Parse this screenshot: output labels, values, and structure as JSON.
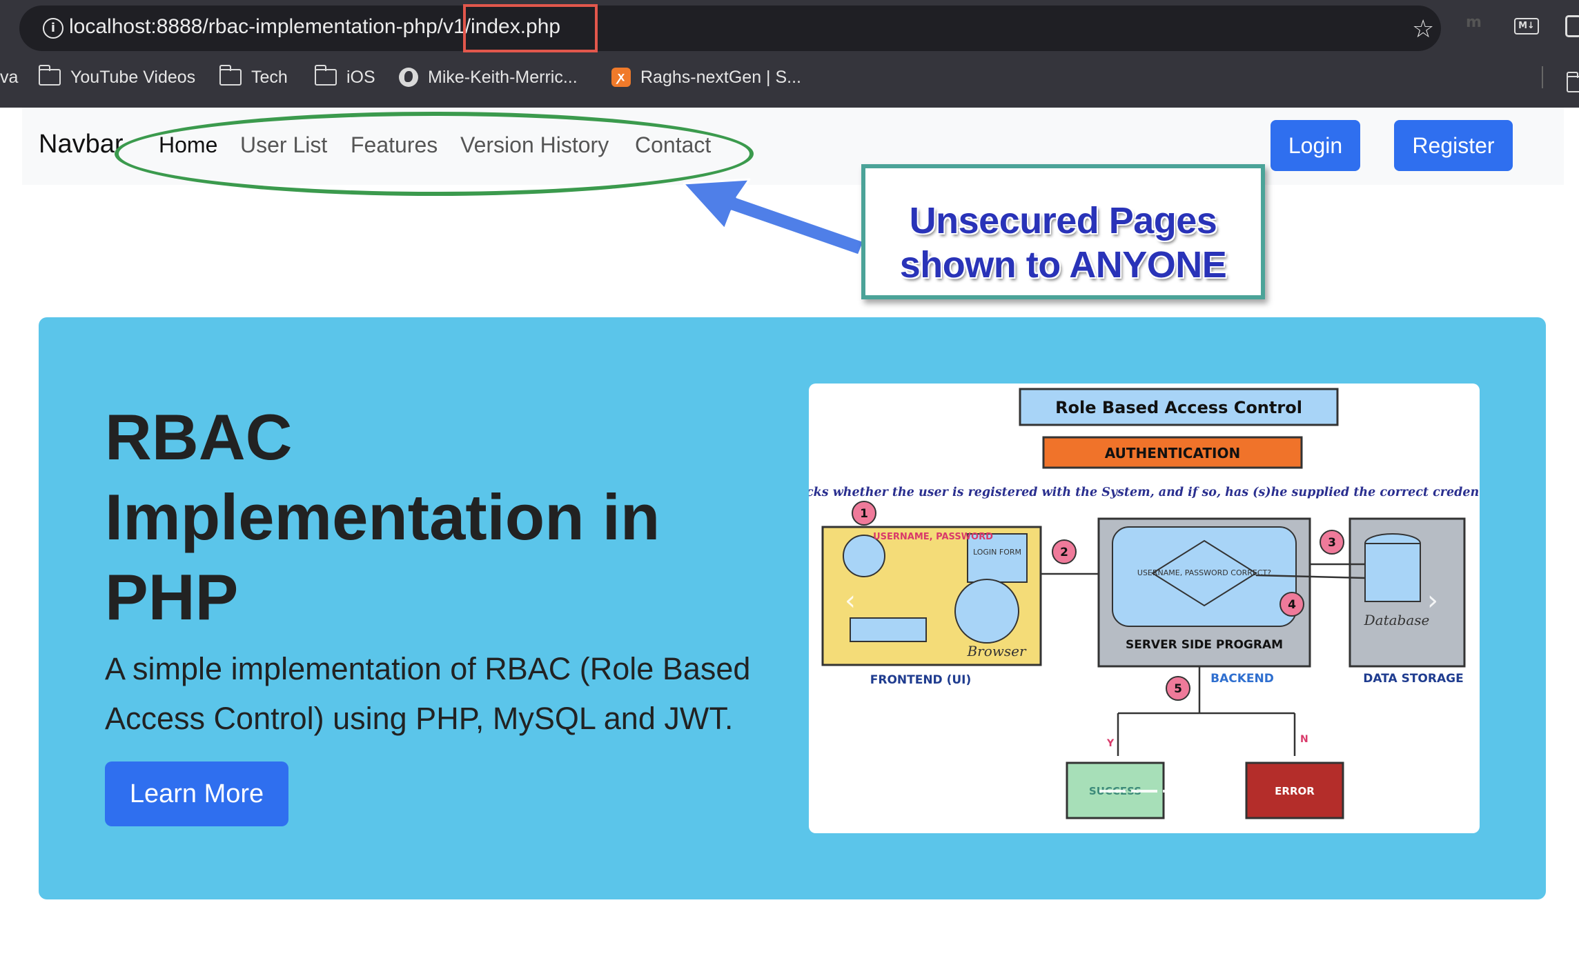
{
  "browser": {
    "url": "localhost:8888/rbac-implementation-php/v1/index.php",
    "bookmarks": [
      {
        "label": "va",
        "icon": "none"
      },
      {
        "label": "YouTube Videos",
        "icon": "folder-icon"
      },
      {
        "label": "Tech",
        "icon": "folder-icon"
      },
      {
        "label": "iOS",
        "icon": "folder-icon"
      },
      {
        "label": "Mike-Keith-Merric...",
        "icon": "globe-icon"
      },
      {
        "label": "Raghs-nextGen | S...",
        "icon": "xampp-icon"
      }
    ],
    "extensions": [
      "m",
      "M↓"
    ]
  },
  "navbar": {
    "brand": "Navbar",
    "links": [
      "Home",
      "User List",
      "Features",
      "Version History",
      "Contact"
    ],
    "active": "Home",
    "login_label": "Login",
    "register_label": "Register"
  },
  "annotation": {
    "line1": "Unsecured Pages",
    "line2": "shown to ANYONE",
    "colors": {
      "ellipse": "#3b9a4d",
      "box_border": "#4ba398",
      "text": "#2933b8",
      "arrow": "#4f7fe8",
      "url_highlight": "#e2574c"
    }
  },
  "hero": {
    "title": "RBAC Implementation in PHP",
    "subtitle": "A simple implementation of RBAC (Role Based Access Control) using PHP, MySQL and JWT.",
    "button_label": "Learn More",
    "background": "#5bc5ea"
  },
  "diagram": {
    "title": "Role Based Access Control",
    "banner": "AUTHENTICATION",
    "caption": "Checks whether the user is registered with the System, and if so, has (s)he supplied the correct credentials",
    "step_numbers": [
      "1",
      "2",
      "3",
      "4",
      "5"
    ],
    "labels": {
      "username_password": "USERNAME, PASSWORD",
      "login_form": "LOGIN FORM",
      "browser": "Browser",
      "check": "USERNAME, PASSWORD CORRECT?",
      "server_side": "SERVER SIDE PROGRAM",
      "database": "Database",
      "frontend": "FRONTEND (UI)",
      "backend": "BACKEND",
      "data_storage": "DATA STORAGE",
      "yes": "Y",
      "no": "N",
      "success": "SUCCESS",
      "error": "ERROR"
    }
  }
}
